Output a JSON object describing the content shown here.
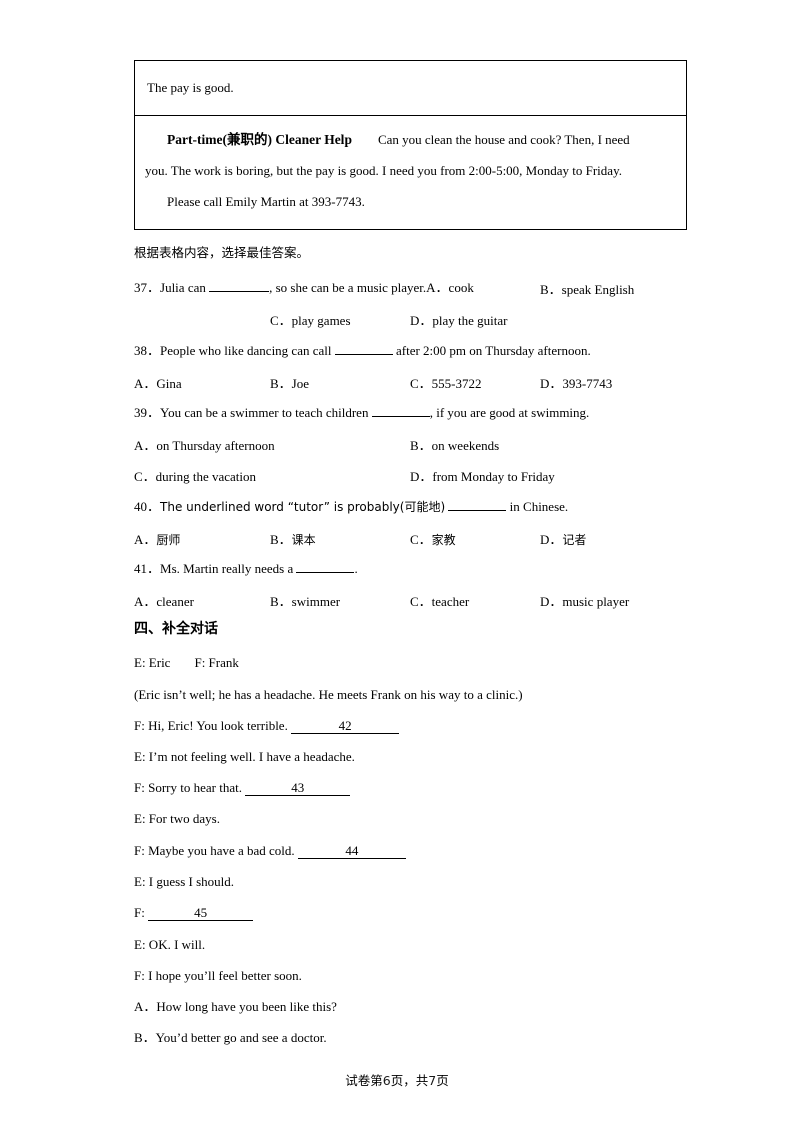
{
  "passage_table": {
    "row1_text": "The pay is good.",
    "row2": {
      "heading": "Part-time(兼职的) Cleaner Help",
      "line1": "Can you clean the house and cook? Then, I need",
      "line2": "you. The work is boring, but the pay is good. I need you from 2:00-5:00, Monday to Friday.",
      "line3": "Please call Emily Martin at 393-7743."
    }
  },
  "instruction": "根据表格内容，选择最佳答案。",
  "questions": [
    {
      "number": "37．",
      "stem_before": "Julia can",
      "stem_after": ", so she can be a music player.",
      "inline_opt_a_marker": "A．",
      "inline_opt_a": "cook",
      "inline_opt_b_marker": "B．",
      "inline_opt_b": "speak English",
      "opt_c_marker": "C．",
      "opt_c": "play games",
      "opt_d_marker": "D．",
      "opt_d": "play the guitar"
    },
    {
      "number": "38．",
      "stem_before": "People who like dancing can call",
      "stem_after": "after 2:00 pm on Thursday afternoon.",
      "options": [
        {
          "marker": "A．",
          "text": "Gina"
        },
        {
          "marker": "B．",
          "text": "Joe"
        },
        {
          "marker": "C．",
          "text": "555-3722"
        },
        {
          "marker": "D．",
          "text": "393-7743"
        }
      ]
    },
    {
      "number": "39．",
      "stem_before": "You can be a swimmer to teach children",
      "stem_after": ", if you are good at swimming.",
      "options_row1": [
        {
          "marker": "A．",
          "text": "on Thursday afternoon"
        },
        {
          "marker": "B．",
          "text": "on weekends"
        }
      ],
      "options_row2": [
        {
          "marker": "C．",
          "text": "during the vacation"
        },
        {
          "marker": "D．",
          "text": "from Monday to Friday"
        }
      ]
    },
    {
      "number": "40．",
      "stem_before": "The underlined word “tutor” is probably(可能地)",
      "stem_after": "in Chinese.",
      "options": [
        {
          "marker": "A．",
          "text": "厨师"
        },
        {
          "marker": "B．",
          "text": "课本"
        },
        {
          "marker": "C．",
          "text": "家教"
        },
        {
          "marker": "D．",
          "text": "记者"
        }
      ]
    },
    {
      "number": "41．",
      "stem_before": "Ms. Martin really needs a",
      "stem_after": ".",
      "options": [
        {
          "marker": "A．",
          "text": "cleaner"
        },
        {
          "marker": "B．",
          "text": "swimmer"
        },
        {
          "marker": "C．",
          "text": "teacher"
        },
        {
          "marker": "D．",
          "text": "music player"
        }
      ]
    }
  ],
  "section_four": {
    "heading": "四、补全对话",
    "speakers": "E: Eric",
    "speakers2": "F: Frank",
    "stage_direction": "(Eric isn’t well; he has a headache. He meets Frank on his way to a clinic.)",
    "dialogue": [
      {
        "text": "F: Hi, Eric! You look terrible.",
        "blank": "42"
      },
      {
        "text": "E: I’m not feeling well. I have a headache.",
        "blank": ""
      },
      {
        "text": "F: Sorry to hear that.",
        "blank": "43"
      },
      {
        "text": "E: For two days.",
        "blank": ""
      },
      {
        "text": "F: Maybe you have a bad cold.",
        "blank": "44"
      },
      {
        "text": "E: I guess I should.",
        "blank": ""
      },
      {
        "text": "F:",
        "blank": "45"
      },
      {
        "text": "E: OK. I will.",
        "blank": ""
      },
      {
        "text": "F: I hope you’ll feel better soon.",
        "blank": ""
      }
    ],
    "choices": [
      {
        "marker": "A．",
        "text": "How long have you been like this?"
      },
      {
        "marker": "B．",
        "text": "You’d better go and see a doctor."
      }
    ]
  },
  "footer": {
    "prefix": "试卷第",
    "current_page": "6",
    "mid": "页，共",
    "total_pages": "7",
    "suffix": "页"
  }
}
